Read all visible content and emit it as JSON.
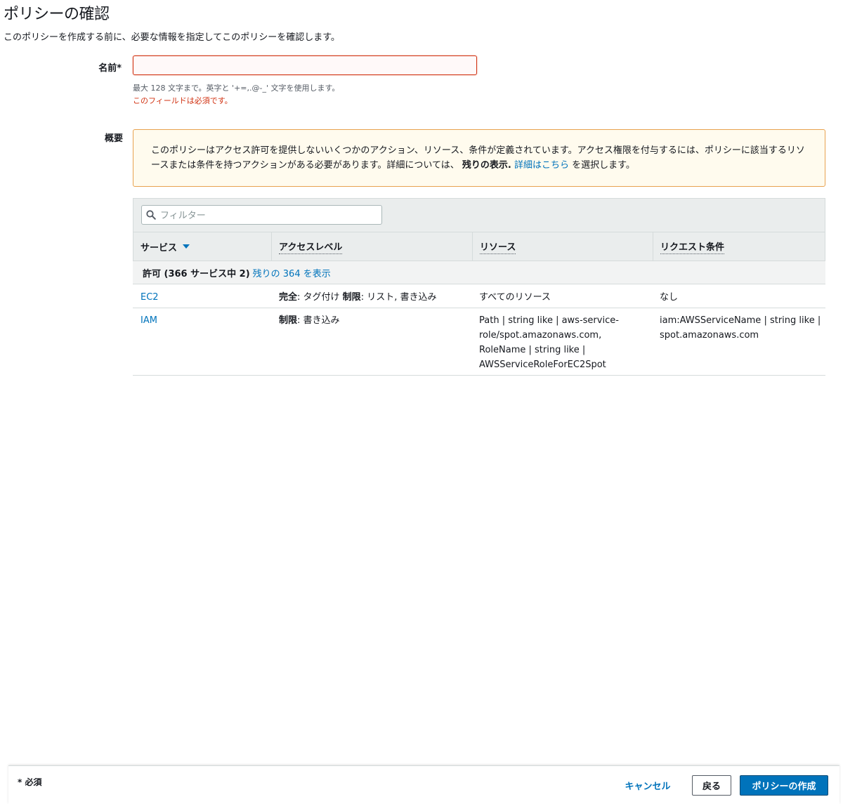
{
  "page": {
    "title": "ポリシーの確認",
    "description": "このポリシーを作成する前に、必要な情報を指定してこのポリシーを確認します。"
  },
  "name_field": {
    "label": "名前*",
    "value": "",
    "hint": "最大 128 文字まで。英字と '+=,.@-_' 文字を使用します。",
    "error": "このフィールドは必須です。"
  },
  "summary": {
    "label": "概要",
    "warning": {
      "text_1": "このポリシーはアクセス許可を提供しないいくつかのアクション、リソース、条件が定義されています。アクセス権限を付与するには、ポリシーに該当するリソースまたは条件を持つアクションがある必要があります。詳細については、",
      "bold": "残りの表示.",
      "link": "詳細はこちら",
      "text_2": "を選択します。"
    }
  },
  "filter": {
    "placeholder": "フィルター",
    "value": ""
  },
  "table": {
    "columns": [
      "サービス",
      "アクセスレベル",
      "リソース",
      "リクエスト条件"
    ],
    "group": {
      "label": "許可 (366 サービス中 2)",
      "link": "残りの 364 を表示"
    },
    "rows": [
      {
        "service": "EC2",
        "access": [
          {
            "bold": "完全",
            "text": ": タグ付け "
          },
          {
            "bold": "制限",
            "text": ": リスト, 書き込み"
          }
        ],
        "resource": "すべてのリソース",
        "condition": "なし"
      },
      {
        "service": "IAM",
        "access": [
          {
            "bold": "制限",
            "text": ": 書き込み"
          }
        ],
        "resource": "Path | string like | aws-service-role/spot.amazonaws.com, RoleName | string like | AWSServiceRoleForEC2Spot",
        "condition": "iam:AWSServiceName | string like | spot.amazonaws.com"
      }
    ]
  },
  "footer": {
    "required_note": "* 必須",
    "cancel": "キャンセル",
    "back": "戻る",
    "create": "ポリシーの作成"
  },
  "colors": {
    "link": "#0073bb",
    "error": "#d13212",
    "warning_border": "#e8a24f",
    "warning_bg": "#fffbee",
    "primary_button": "#0073bb"
  }
}
